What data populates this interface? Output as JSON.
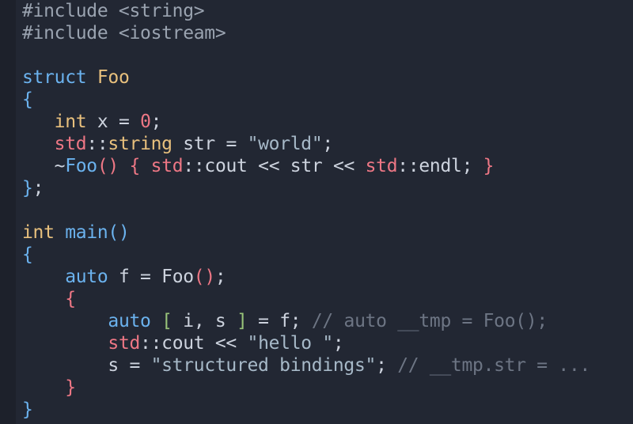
{
  "editor": {
    "background": "#222733",
    "lines": [
      [
        {
          "c": "pp",
          "t": "#include <string>"
        }
      ],
      [
        {
          "c": "pp",
          "t": "#include <iostream>"
        }
      ],
      [],
      [
        {
          "c": "kw",
          "t": "struct"
        },
        {
          "c": "tx",
          "t": " "
        },
        {
          "c": "ty",
          "t": "Foo"
        }
      ],
      [
        {
          "c": "br1",
          "t": "{"
        }
      ],
      [
        {
          "c": "tx",
          "t": "   "
        },
        {
          "c": "ty",
          "t": "int"
        },
        {
          "c": "tx",
          "t": " x = "
        },
        {
          "c": "num",
          "t": "0"
        },
        {
          "c": "tx",
          "t": ";"
        }
      ],
      [
        {
          "c": "tx",
          "t": "   "
        },
        {
          "c": "ns",
          "t": "std"
        },
        {
          "c": "tx",
          "t": "::"
        },
        {
          "c": "ty",
          "t": "string"
        },
        {
          "c": "tx",
          "t": " str = "
        },
        {
          "c": "str",
          "t": "\"world\""
        },
        {
          "c": "tx",
          "t": ";"
        }
      ],
      [
        {
          "c": "tx",
          "t": "   ~"
        },
        {
          "c": "fn",
          "t": "Foo"
        },
        {
          "c": "br2",
          "t": "()"
        },
        {
          "c": "tx",
          "t": " "
        },
        {
          "c": "br2",
          "t": "{"
        },
        {
          "c": "tx",
          "t": " "
        },
        {
          "c": "ns",
          "t": "std"
        },
        {
          "c": "tx",
          "t": "::cout << str << "
        },
        {
          "c": "ns",
          "t": "std"
        },
        {
          "c": "tx",
          "t": "::endl; "
        },
        {
          "c": "br2",
          "t": "}"
        }
      ],
      [
        {
          "c": "br1",
          "t": "}"
        },
        {
          "c": "tx",
          "t": ";"
        }
      ],
      [],
      [
        {
          "c": "ty",
          "t": "int"
        },
        {
          "c": "tx",
          "t": " "
        },
        {
          "c": "fn",
          "t": "main"
        },
        {
          "c": "br1",
          "t": "()"
        }
      ],
      [
        {
          "c": "br1",
          "t": "{"
        }
      ],
      [
        {
          "c": "tx",
          "t": "    "
        },
        {
          "c": "kw",
          "t": "auto"
        },
        {
          "c": "tx",
          "t": " f = Foo"
        },
        {
          "c": "br2",
          "t": "()"
        },
        {
          "c": "tx",
          "t": ";"
        }
      ],
      [
        {
          "c": "tx",
          "t": "    "
        },
        {
          "c": "br2",
          "t": "{"
        }
      ],
      [
        {
          "c": "tx",
          "t": "        "
        },
        {
          "c": "kw",
          "t": "auto"
        },
        {
          "c": "tx",
          "t": " "
        },
        {
          "c": "br3",
          "t": "["
        },
        {
          "c": "tx",
          "t": " i, s "
        },
        {
          "c": "br3",
          "t": "]"
        },
        {
          "c": "tx",
          "t": " = f; "
        },
        {
          "c": "cm",
          "t": "// auto __tmp = Foo();"
        }
      ],
      [
        {
          "c": "tx",
          "t": "        "
        },
        {
          "c": "ns",
          "t": "std"
        },
        {
          "c": "tx",
          "t": "::cout << "
        },
        {
          "c": "str",
          "t": "\"hello \""
        },
        {
          "c": "tx",
          "t": ";"
        }
      ],
      [
        {
          "c": "tx",
          "t": "        s = "
        },
        {
          "c": "str",
          "t": "\"structured bindings\""
        },
        {
          "c": "tx",
          "t": "; "
        },
        {
          "c": "cm",
          "t": "// __tmp.str = ..."
        }
      ],
      [
        {
          "c": "tx",
          "t": "    "
        },
        {
          "c": "br2",
          "t": "}"
        }
      ],
      [
        {
          "c": "br1",
          "t": "}"
        }
      ]
    ]
  }
}
